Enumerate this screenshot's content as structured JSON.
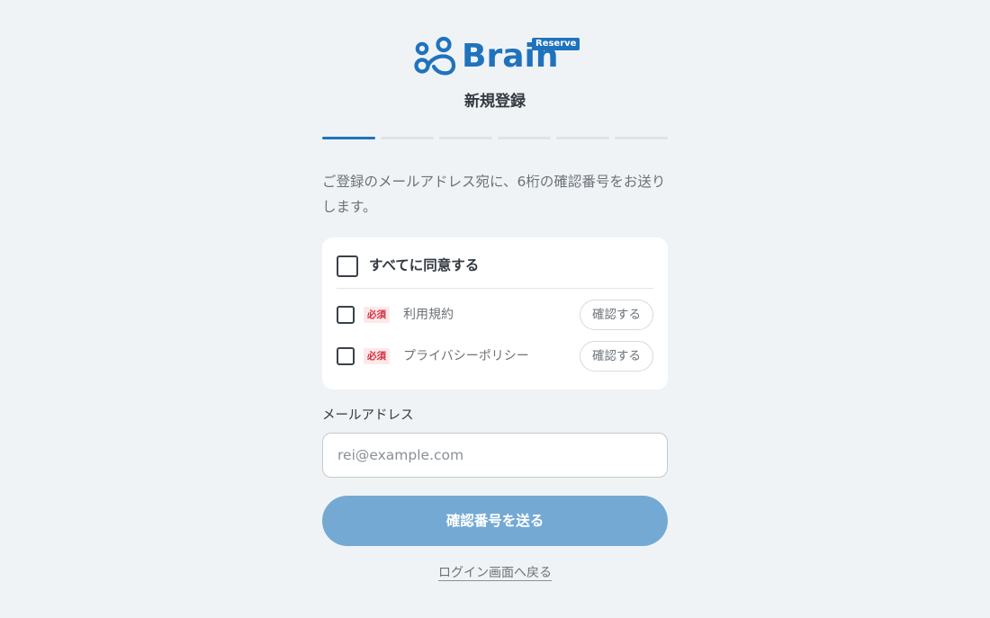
{
  "brand": {
    "name": "Brain",
    "badge": "Reserve",
    "color": "#1f73bd"
  },
  "page_title": "新規登録",
  "stepper": {
    "total_steps": 6,
    "current_step": 1
  },
  "intro_text": "ご登録のメールアドレス宛に、6桁の確認番号をお送りします。",
  "consent": {
    "all_label": "すべてに同意する",
    "all_checked": false,
    "items": [
      {
        "required_badge": "必須",
        "label": "利用規約",
        "confirm_label": "確認する",
        "checked": false
      },
      {
        "required_badge": "必須",
        "label": "プライバシーポリシー",
        "confirm_label": "確認する",
        "checked": false
      }
    ]
  },
  "email": {
    "label": "メールアドレス",
    "placeholder": "rei@example.com",
    "value": ""
  },
  "submit_label": "確認番号を送る",
  "back_link_label": "ログイン画面へ戻る",
  "icons": {
    "logo": "brain-people-logo-icon"
  }
}
